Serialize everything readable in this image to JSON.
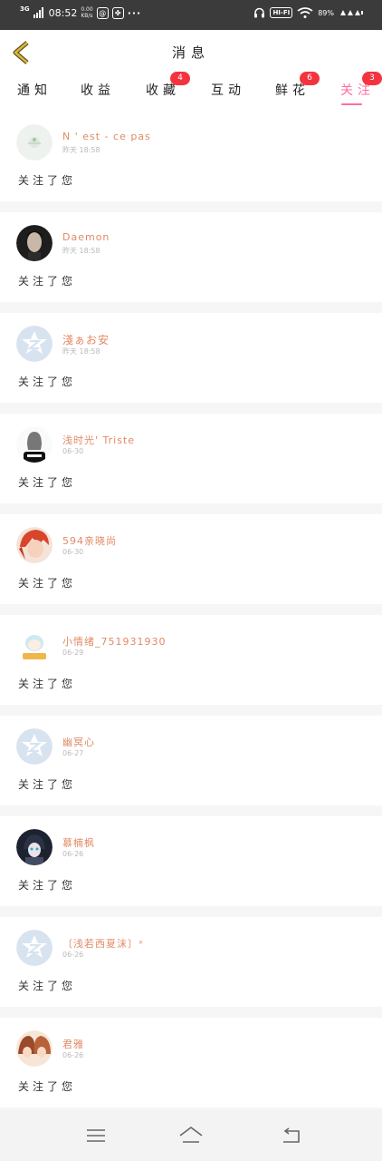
{
  "status_bar": {
    "network": "3G",
    "time": "08:52",
    "speed_top": "0.00",
    "speed_bottom": "KB/s",
    "dots": "···",
    "hifi": "HI-FI",
    "battery": "89%"
  },
  "header": {
    "title": "消息"
  },
  "tabs": [
    {
      "label": "通知",
      "badge": ""
    },
    {
      "label": "收益",
      "badge": ""
    },
    {
      "label": "收藏",
      "badge": "4"
    },
    {
      "label": "互动",
      "badge": ""
    },
    {
      "label": "鲜花",
      "badge": "6"
    },
    {
      "label": "关注",
      "badge": "3",
      "active": true
    }
  ],
  "follows": [
    {
      "name": "N ' est - ce pas",
      "time": "昨天 18:58",
      "message": "关注了您",
      "avatar": "flower-avatar"
    },
    {
      "name": "Daemon",
      "time": "昨天 18:58",
      "message": "关注了您",
      "avatar": "man-photo-avatar"
    },
    {
      "name": "淺ぁお安",
      "time": "昨天 18:58",
      "message": "关注了您",
      "avatar": "default-avatar"
    },
    {
      "name": "浅时光' Triste",
      "time": "06-30",
      "message": "关注了您",
      "avatar": "girl-drawing-avatar"
    },
    {
      "name": "594亲晓尚",
      "time": "06-30",
      "message": "关注了您",
      "avatar": "anime-red-hair-avatar"
    },
    {
      "name": "小情绪_751931930",
      "time": "06-29",
      "message": "关注了您",
      "avatar": "chibi-avatar"
    },
    {
      "name": "幽冥心",
      "time": "06-27",
      "message": "关注了您",
      "avatar": "default-avatar"
    },
    {
      "name": "慕楠枫",
      "time": "06-26",
      "message": "关注了您",
      "avatar": "dark-anime-avatar"
    },
    {
      "name": "〔浅若西夏沫〕ˣ",
      "time": "06-26",
      "message": "关注了您",
      "avatar": "default-avatar"
    },
    {
      "name": "君雅",
      "time": "06-26",
      "message": "关注了您",
      "avatar": "anime-girls-avatar"
    }
  ],
  "colors": {
    "accent": "#ff6e9b",
    "badge": "#f3343f",
    "username": "#e08a64",
    "back_arrow": "#c9a227"
  }
}
